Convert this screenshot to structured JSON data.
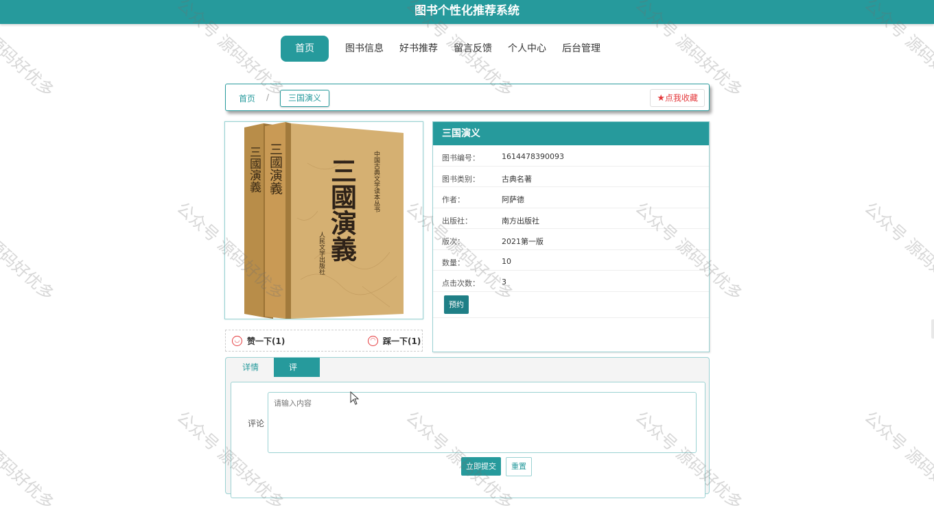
{
  "app": {
    "title": "图书个性化推荐系统"
  },
  "nav": [
    {
      "label": "首页",
      "active": true
    },
    {
      "label": "图书信息"
    },
    {
      "label": "好书推荐"
    },
    {
      "label": "留言反馈"
    },
    {
      "label": "个人中心"
    },
    {
      "label": "后台管理"
    }
  ],
  "breadcrumb": {
    "home": "首页",
    "sep": "/",
    "current": "三国演义"
  },
  "favorite": {
    "icon": "star-icon",
    "label": "点我收藏"
  },
  "book": {
    "name": "三国演义",
    "fields": [
      {
        "key": "图书编号：",
        "value": "1614478390093"
      },
      {
        "key": "图书类别：",
        "value": "古典名著"
      },
      {
        "key": "作者：",
        "value": "阿萨德"
      },
      {
        "key": "出版社：",
        "value": "南方出版社"
      },
      {
        "key": "版次：",
        "value": "2021第一版"
      },
      {
        "key": "数量：",
        "value": "10"
      },
      {
        "key": "点击次数：",
        "value": "3"
      }
    ],
    "reserve_label": "预约",
    "cover": {
      "title_vertical": "三國演義",
      "side_text": "中国古典文学读本丛书",
      "publisher": "人民文学出版社"
    }
  },
  "votes": {
    "up_label": "赞一下(1)",
    "down_label": "踩一下(1)"
  },
  "tabs": [
    {
      "label": "详情"
    },
    {
      "label": "评论",
      "active": true
    }
  ],
  "comment": {
    "label": "评论",
    "placeholder": "请输入内容",
    "submit_label": "立即提交",
    "reset_label": "重置"
  },
  "watermark": "公众号 源码好优多",
  "colors": {
    "primary": "#269a9c",
    "danger": "#e4393c"
  }
}
